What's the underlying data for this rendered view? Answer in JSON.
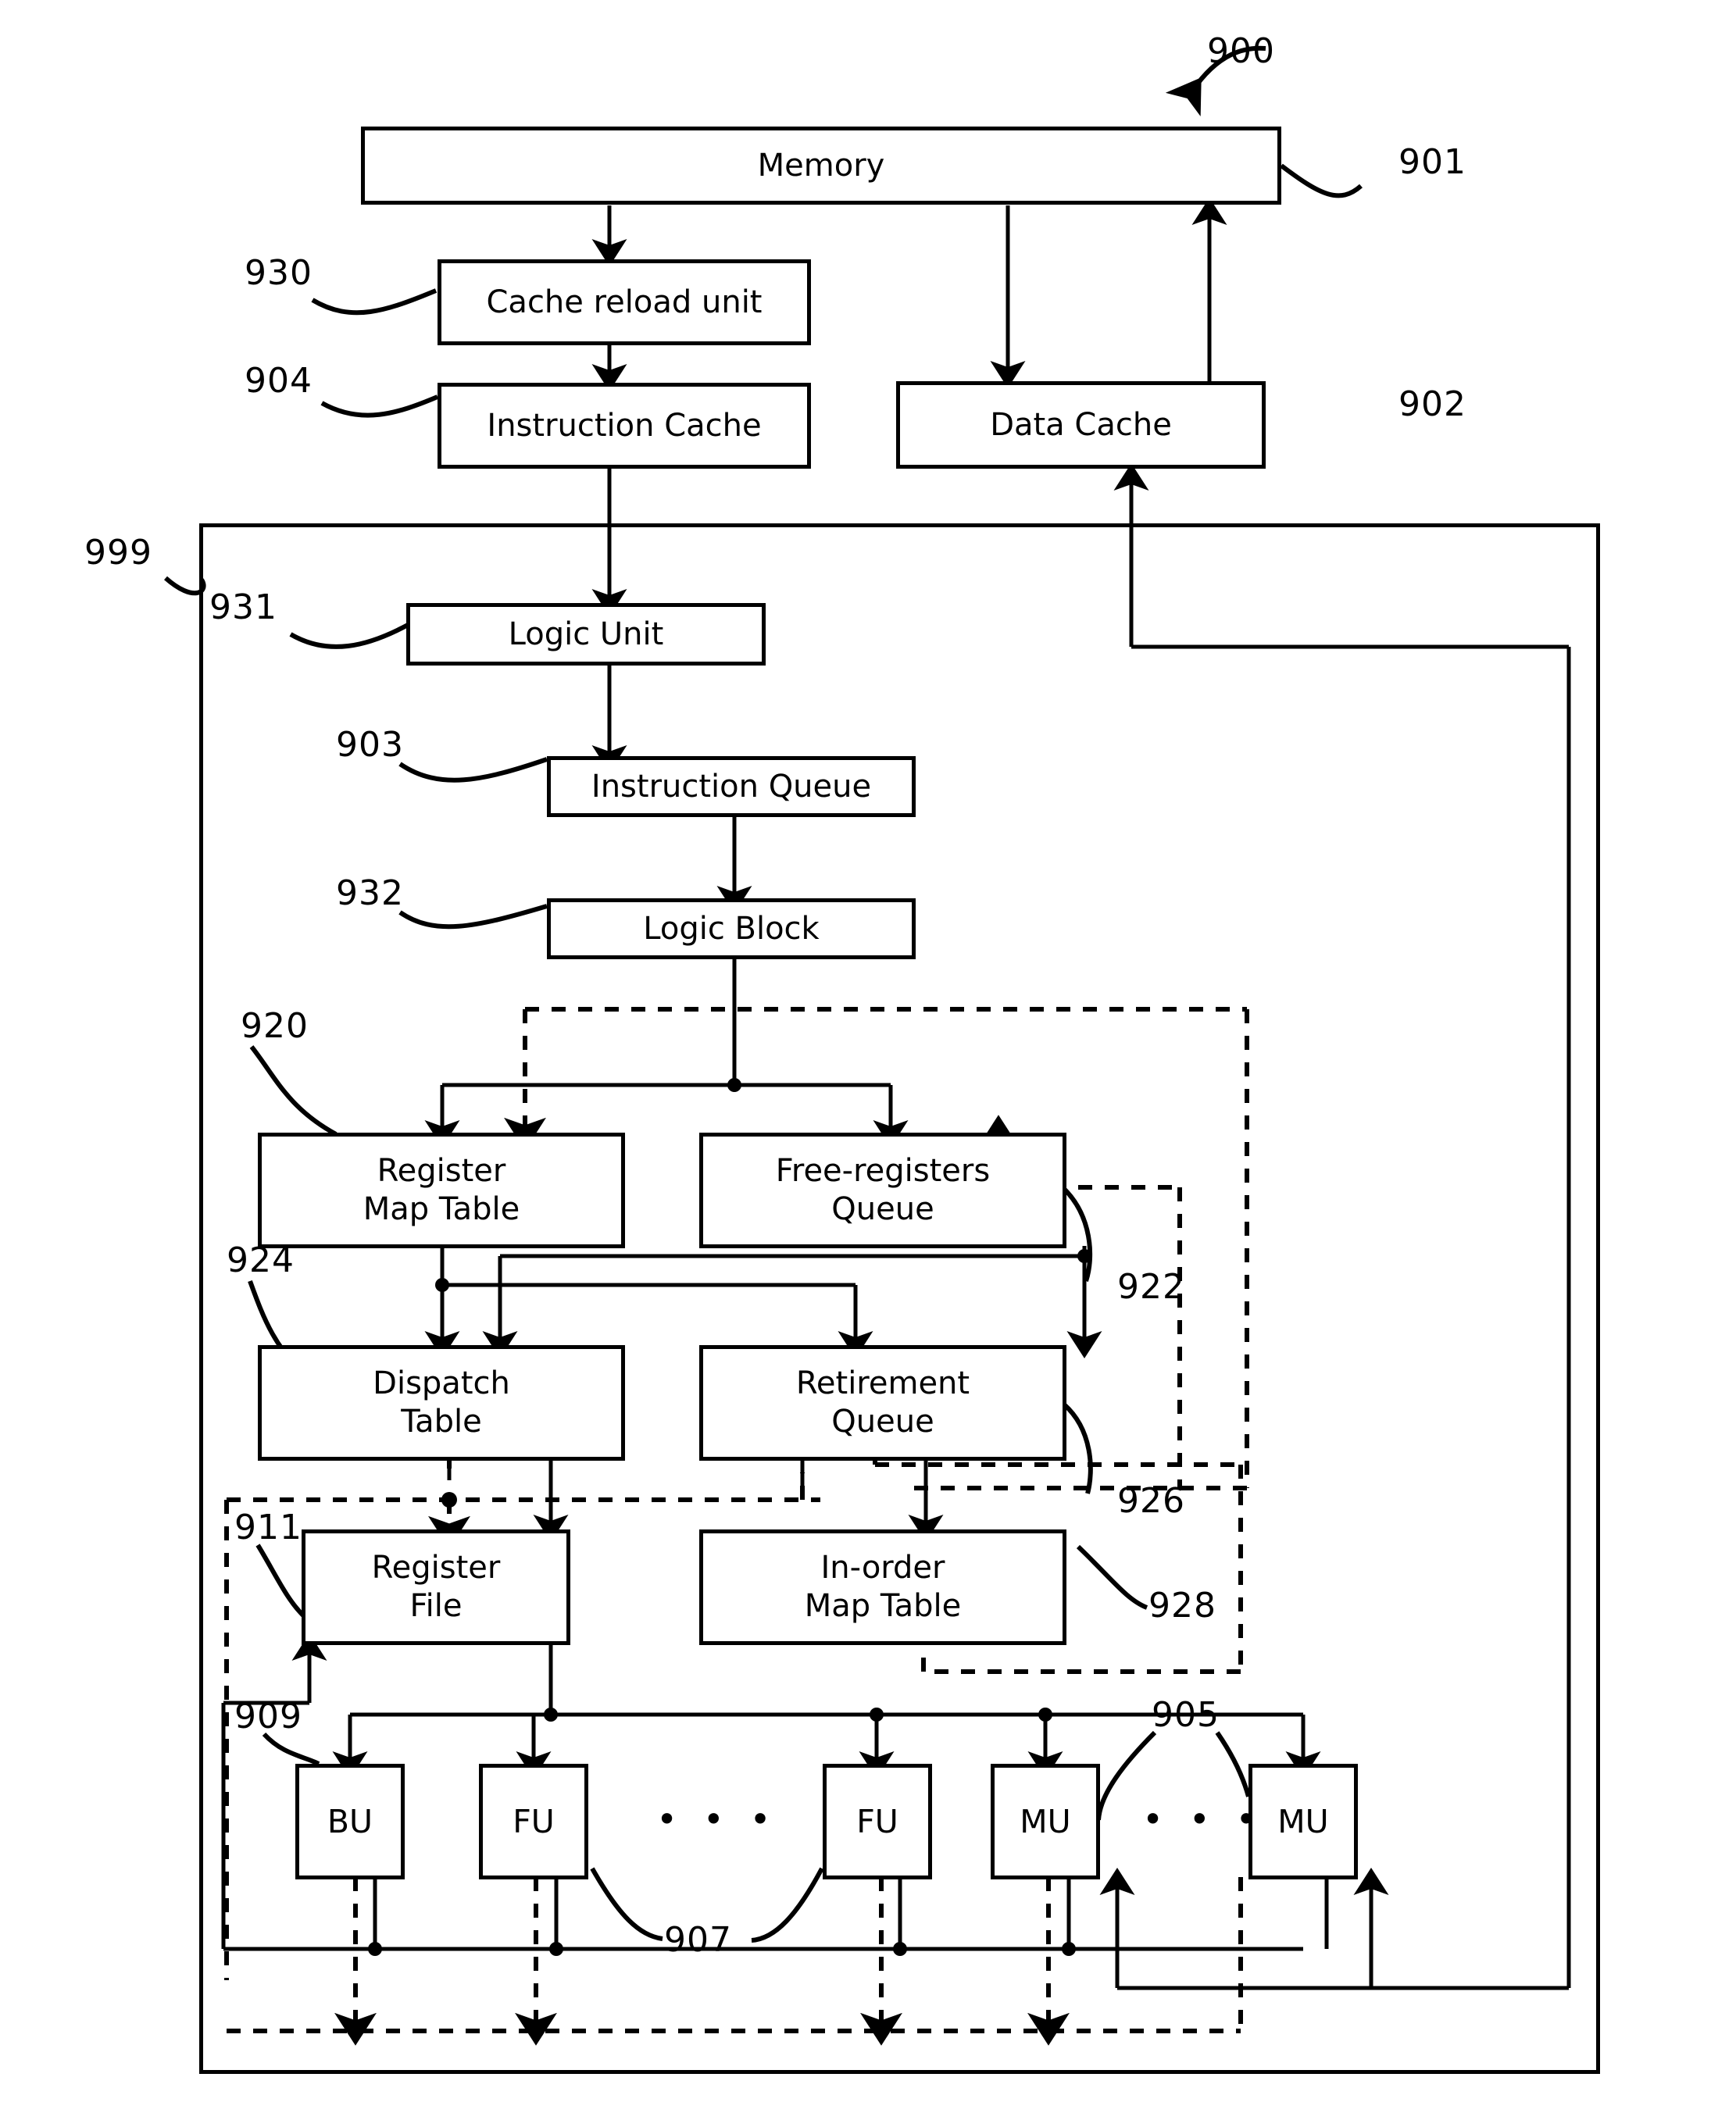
{
  "figure": {
    "id": "900",
    "type": "patent-block-diagram",
    "title": "Processor block diagram"
  },
  "blocks": [
    {
      "key": "memory",
      "label": "Memory",
      "lines": [
        "Memory"
      ],
      "ref": "901"
    },
    {
      "key": "cache_reload_unit",
      "label": "Cache reload unit",
      "lines": [
        "Cache reload unit"
      ],
      "ref": "930"
    },
    {
      "key": "instruction_cache",
      "label": "Instruction Cache",
      "lines": [
        "Instruction Cache"
      ],
      "ref": "904"
    },
    {
      "key": "data_cache",
      "label": "Data Cache",
      "lines": [
        "Data Cache"
      ],
      "ref": "902"
    },
    {
      "key": "logic_unit",
      "label": "Logic Unit",
      "lines": [
        "Logic Unit"
      ],
      "ref": "931"
    },
    {
      "key": "instruction_queue",
      "label": "Instruction Queue",
      "lines": [
        "Instruction Queue"
      ],
      "ref": "903"
    },
    {
      "key": "logic_block",
      "label": "Logic Block",
      "lines": [
        "Logic Block"
      ],
      "ref": "932"
    },
    {
      "key": "register_map_table",
      "label": "Register Map Table",
      "lines": [
        "Register",
        "Map Table"
      ],
      "ref": "920"
    },
    {
      "key": "free_registers_queue",
      "label": "Free-registers Queue",
      "lines": [
        "Free-registers",
        "Queue"
      ],
      "ref": "922"
    },
    {
      "key": "dispatch_table",
      "label": "Dispatch Table",
      "lines": [
        "Dispatch",
        "Table"
      ],
      "ref": "924"
    },
    {
      "key": "retirement_queue",
      "label": "Retirement Queue",
      "lines": [
        "Retirement",
        "Queue"
      ],
      "ref": "926"
    },
    {
      "key": "register_file",
      "label": "Register File",
      "lines": [
        "Register",
        "File"
      ],
      "ref": "911"
    },
    {
      "key": "in_order_map_table",
      "label": "In-order Map Table",
      "lines": [
        "In-order",
        "Map Table"
      ],
      "ref": "928"
    }
  ],
  "functional_units": [
    {
      "key": "bu",
      "label": "BU",
      "ref": "909"
    },
    {
      "key": "fu1",
      "label": "FU",
      "ref": ""
    },
    {
      "key": "fu2",
      "label": "FU",
      "ref": "907"
    },
    {
      "key": "mu1",
      "label": "MU",
      "ref": "905"
    },
    {
      "key": "mu2",
      "label": "MU",
      "ref": ""
    }
  ],
  "ellipses": {
    "fu_ellipsis": "• • •",
    "mu_ellipsis": "• • •"
  },
  "reference_numerals": {
    "figure": "900",
    "memory": "901",
    "data_cache": "902",
    "instruction_queue": "903",
    "instruction_cache": "904",
    "memory_units": "905",
    "functional_units": "907",
    "branch_unit": "909",
    "register_file": "911",
    "register_map_table": "920",
    "free_registers_queue": "922",
    "dispatch_table": "924",
    "retirement_queue": "926",
    "in_order_map_table": "928",
    "cache_reload_unit": "930",
    "logic_unit": "931",
    "logic_block": "932",
    "processor": "999"
  },
  "colors": {
    "stroke": "#000000",
    "background": "#ffffff"
  }
}
